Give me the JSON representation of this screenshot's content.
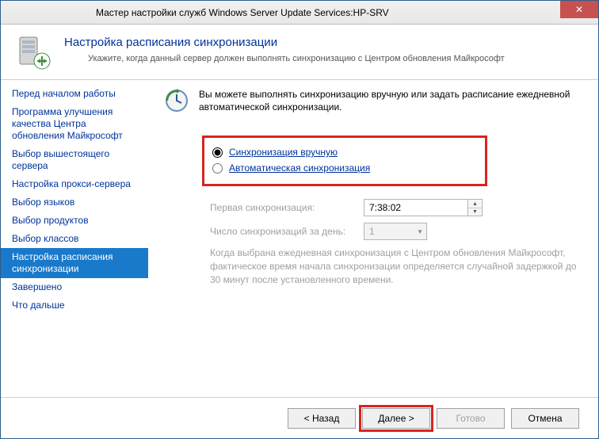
{
  "window": {
    "title": "Мастер настройки служб Windows Server Update Services:HP-SRV"
  },
  "header": {
    "title": "Настройка расписания синхронизации",
    "subtitle": "Укажите, когда данный сервер должен выполнять синхронизацию с Центром обновления Майкрософт"
  },
  "nav": {
    "items": [
      "Перед началом работы",
      "Программа улучшения качества Центра обновления Майкрософт",
      "Выбор вышестоящего сервера",
      "Настройка прокси-сервера",
      "Выбор языков",
      "Выбор продуктов",
      "Выбор классов",
      "Настройка расписания синхронизации",
      "Завершено",
      "Что дальше"
    ],
    "selectedIndex": 7
  },
  "content": {
    "intro": "Вы можете выполнять синхронизацию вручную или задать расписание ежедневной автоматической синхронизации.",
    "radios": {
      "manual": "Синхронизация вручную",
      "auto": "Автоматическая синхронизация",
      "selected": "manual"
    },
    "firstSyncLabel": "Первая синхронизация:",
    "firstSyncValue": "7:38:02",
    "perDayLabel": "Число синхронизаций за день:",
    "perDayValue": "1",
    "note": "Когда выбрана ежедневная синхронизация с Центром обновления Майкрософт, фактическое время начала синхронизации определяется случайной задержкой до 30 минут после установленного времени."
  },
  "footer": {
    "back": "< Назад",
    "next": "Далее >",
    "finish": "Готово",
    "cancel": "Отмена"
  }
}
